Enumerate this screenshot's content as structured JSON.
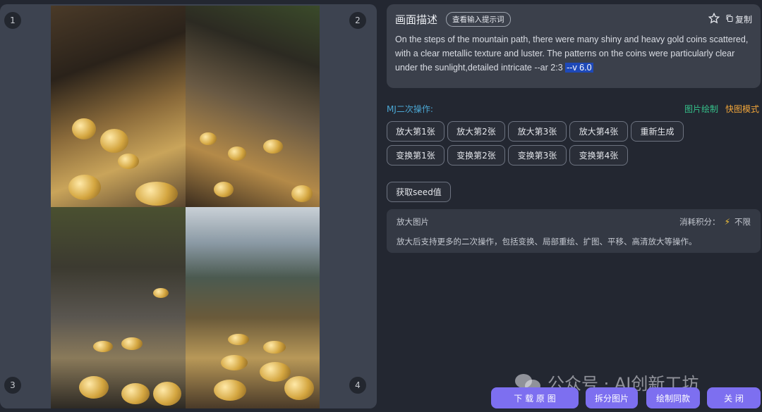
{
  "preview": {
    "numbers": [
      "1",
      "2",
      "3",
      "4"
    ]
  },
  "prompt_card": {
    "title": "画面描述",
    "view_prompt_tag": "查看输入提示词",
    "copy_label": "复制",
    "text_main": "On the steps of the mountain path, there were many shiny and heavy gold coins scattered, with a clear metallic texture and luster. The patterns on the coins were particularly clear under the sunlight,detailed intricate --ar 2:3 ",
    "text_highlight": "--v 6.0"
  },
  "mj": {
    "label": "MJ二次操作:",
    "link_draw": "图片绘制",
    "link_fast": "快图模式",
    "upscale_buttons": [
      "放大第1张",
      "放大第2张",
      "放大第3张",
      "放大第4张",
      "重新生成"
    ],
    "variation_buttons": [
      "变换第1张",
      "变换第2张",
      "变换第3张",
      "变换第4张"
    ],
    "seed_button": "获取seed值"
  },
  "info_card": {
    "title": "放大图片",
    "cost_label": "消耗积分：",
    "cost_value": "不限",
    "description": "放大后支持更多的二次操作，包括变换、局部重绘、扩图、平移、高清放大等操作。"
  },
  "watermark": "公众号 · AI创新工坊",
  "bottom_buttons": {
    "download": "下 载 原 图",
    "split": "拆分图片",
    "draw_same": "绘制同款",
    "close": "关 闭"
  },
  "colors": {
    "accent_purple": "#7d6ff0",
    "mj_label": "#4ba7d4",
    "link_green": "#35c08a",
    "link_orange": "#f0a53a",
    "highlight_blue": "#1e49b8"
  }
}
